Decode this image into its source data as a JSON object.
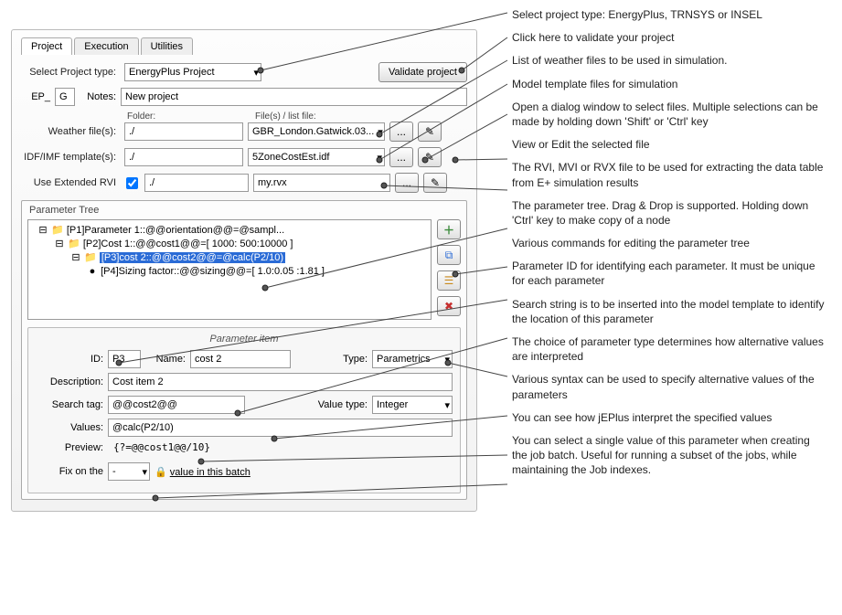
{
  "tabs": {
    "project": "Project",
    "execution": "Execution",
    "utilities": "Utilities"
  },
  "labels": {
    "selectProjectType": "Select Project type:",
    "ep": "EP_",
    "epval": "G",
    "notes": "Notes:",
    "folder": "Folder:",
    "filelist": "File(s) / list file:",
    "weather": "Weather file(s):",
    "idf": "IDF/IMF template(s):",
    "rvi": "Use Extended RVI",
    "paramTree": "Parameter Tree",
    "paramItem": "Parameter item",
    "id": "ID:",
    "name": "Name:",
    "type": "Type:",
    "desc": "Description:",
    "searchtag": "Search tag:",
    "valuetype": "Value type:",
    "values": "Values:",
    "preview": "Preview:",
    "fixon": "Fix on the",
    "valuebatch": "value in this batch"
  },
  "values": {
    "projectType": "EnergyPlus Project",
    "validate": "Validate project",
    "notes": "New project",
    "weatherFolder": "./",
    "weatherFile": "GBR_London.Gatwick.03...",
    "idfFolder": "./",
    "idfFile": "5ZoneCostEst.idf",
    "rviFolder": "./",
    "rviFile": "my.rvx",
    "tree": {
      "n1": "[P1]Parameter 1::@@orientation@@=@sampl...",
      "n2": "[P2]Cost 1::@@cost1@@=[ 1000: 500:10000 ]",
      "n3": "[P3]cost 2::@@cost2@@=@calc(P2/10)",
      "n4": "[P4]Sizing factor::@@sizing@@=[ 1.0:0.05 :1.81 ]"
    },
    "id": "P3",
    "name": "cost 2",
    "type": "Parametrics",
    "desc": "Cost item 2",
    "searchtag": "@@cost2@@",
    "valuetype": "Integer",
    "valuesText": "@calc(P2/10)",
    "preview": "{?=@@cost1@@/10}",
    "fixon": "-"
  },
  "ellipsis": "...",
  "annotations": {
    "a1": "Select project type: EnergyPlus, TRNSYS or INSEL",
    "a2": "Click here to validate your project",
    "a3": "List of weather files to be used in simulation.",
    "a4": "Model template files for simulation",
    "a5": "Open a dialog window to select files. Multiple selections can be made by holding down 'Shift' or 'Ctrl' key",
    "a6": "View or Edit the selected file",
    "a7": "The RVI, MVI or RVX file to be used for extracting the data table from E+ simulation results",
    "a8": "The parameter tree. Drag & Drop is supported. Holding down 'Ctrl' key to make copy of a node",
    "a9": "Various commands for editing the parameter tree",
    "a10": "Parameter ID for identifying each parameter. It must be unique for each parameter",
    "a11": "Search string is to be inserted into the model template to identify the location of this parameter",
    "a12": "The choice of parameter type determines how alternative values are interpreted",
    "a13": "Various syntax can be used to specify alternative values of the parameters",
    "a14": "You can see how jEPlus interpret the specified values",
    "a15": "You can select a single value of this parameter when creating the job batch. Useful for running a subset of the jobs, while maintaining the Job indexes."
  }
}
